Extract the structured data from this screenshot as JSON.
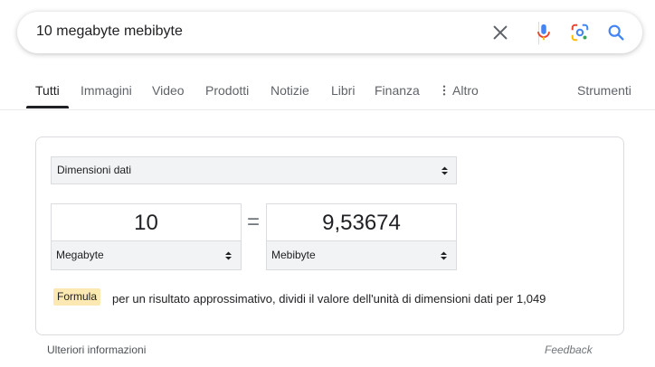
{
  "search": {
    "query": "10 megabyte mebibyte"
  },
  "icons": {
    "clear": "close-icon",
    "voice": "microphone-icon",
    "lens": "camera-lens-icon",
    "search": "search-icon"
  },
  "tabs": [
    {
      "label": "Tutti",
      "active": true
    },
    {
      "label": "Immagini"
    },
    {
      "label": "Video"
    },
    {
      "label": "Prodotti"
    },
    {
      "label": "Notizie"
    },
    {
      "label": "Libri"
    },
    {
      "label": "Finanza"
    },
    {
      "label": "Altro"
    }
  ],
  "tools_label": "Strumenti",
  "converter": {
    "category": "Dimensioni dati",
    "from_value": "10",
    "from_unit": "Megabyte",
    "to_value": "9,53674",
    "to_unit": "Mebibyte",
    "equals": "=",
    "formula_label": "Formula",
    "formula_text": "per un risultato approssimativo, dividi il valore dell'unità di dimensioni dati per 1,049"
  },
  "footer": {
    "more_info": "Ulteriori informazioni",
    "feedback": "Feedback"
  },
  "colors": {
    "mic_blue": "#4285f4",
    "mic_red": "#ea4335",
    "mic_yellow": "#fbbc04",
    "mic_green": "#34a853",
    "search_blue": "#4285f4",
    "formula_bg": "#fce8b2"
  }
}
